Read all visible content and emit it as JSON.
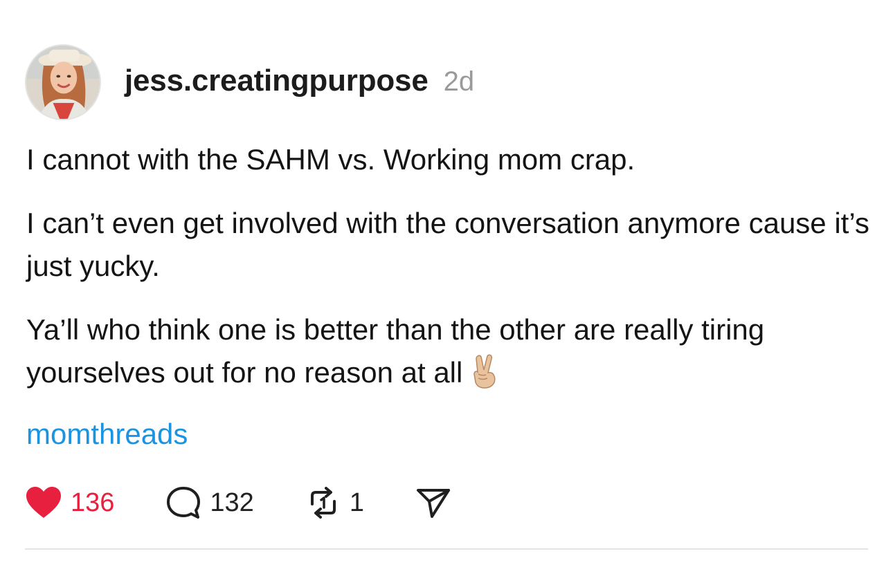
{
  "post": {
    "author": {
      "username": "jess.creatingpurpose",
      "avatar_icon": "profile-photo"
    },
    "timestamp": "2d",
    "paragraphs": [
      "I cannot with the SAHM vs. Working mom crap.",
      "I can’t even get involved with the conversation anymore cause it’s just yucky.",
      "Ya’ll who think one is better than the other are really tiring yourselves out for no reason at all"
    ],
    "trailing_emoji": "victory-hand-emoji",
    "tag": "momthreads",
    "actions": {
      "likes": "136",
      "replies": "132",
      "reposts": "1",
      "like_icon": "heart-icon",
      "reply_icon": "comment-bubble-icon",
      "repost_icon": "repost-icon",
      "share_icon": "send-icon"
    },
    "colors": {
      "like": "#e8203f",
      "tag": "#1a94e0",
      "timestamp": "#9a9a9a"
    }
  }
}
